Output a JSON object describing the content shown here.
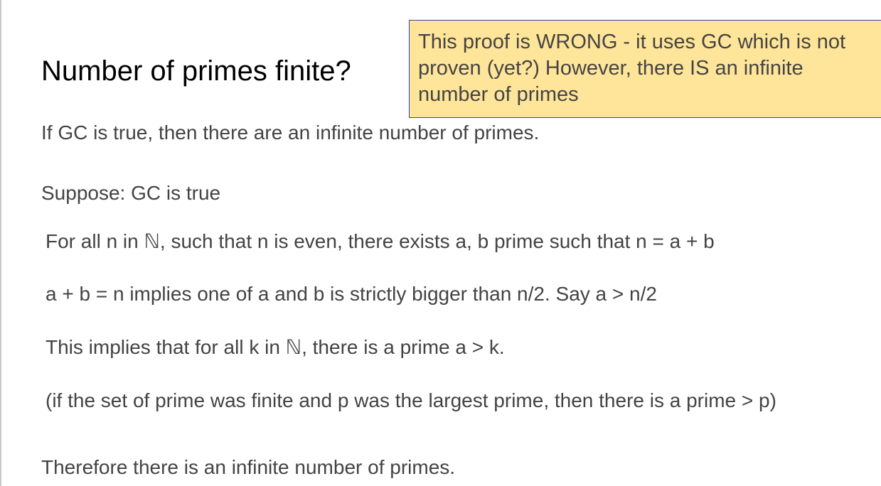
{
  "slide": {
    "title": "Number of primes finite?",
    "note": "This proof is WRONG - it uses GC which is not proven (yet?) However, there IS an infinite number of primes",
    "lines": [
      "If GC is true, then there are an infinite number of primes.",
      "Suppose: GC is true",
      "For all n in ℕ, such that n is even, there exists a, b prime such that  n = a + b",
      "a + b = n implies one of a and b is strictly bigger than n/2. Say a > n/2",
      "This implies that for all k in ℕ, there is a prime a > k.",
      "(if the set of prime was finite and p was the largest prime, then there is a prime > p)",
      "Therefore there is an infinite number of primes."
    ]
  },
  "colors": {
    "note_background": "#ffe599",
    "note_border": "#3c3cac",
    "body_text": "#434343",
    "title_text": "#000000"
  }
}
